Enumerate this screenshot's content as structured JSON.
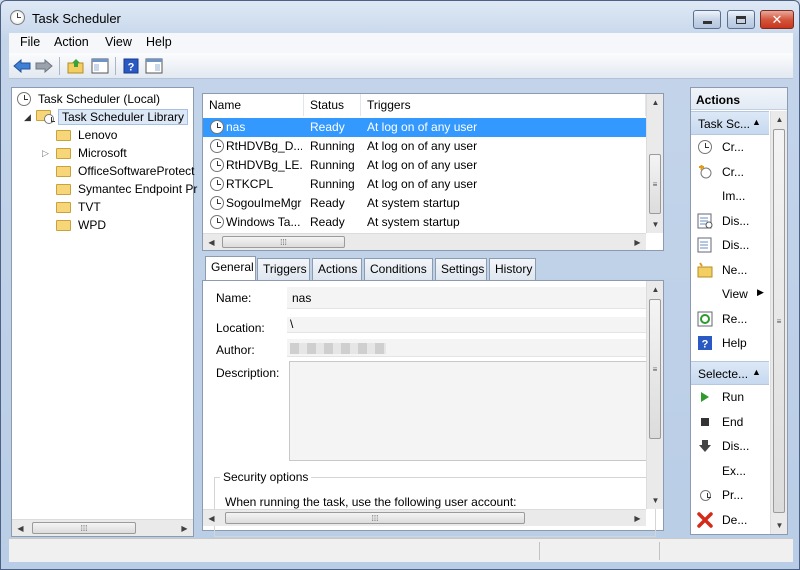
{
  "window": {
    "title": "Task Scheduler"
  },
  "menu": [
    "File",
    "Action",
    "View",
    "Help"
  ],
  "tree": {
    "root": "Task Scheduler (Local)",
    "library": "Task Scheduler Library",
    "folders": [
      "Lenovo",
      "Microsoft",
      "OfficeSoftwareProtect",
      "Symantec Endpoint Pr",
      "TVT",
      "WPD"
    ]
  },
  "tasks": {
    "columns": [
      "Name",
      "Status",
      "Triggers"
    ],
    "rows": [
      {
        "name": "nas",
        "status": "Ready",
        "trigger": "At log on of any user"
      },
      {
        "name": "RtHDVBg_D...",
        "status": "Running",
        "trigger": "At log on of any user"
      },
      {
        "name": "RtHDVBg_LE...",
        "status": "Running",
        "trigger": "At log on of any user"
      },
      {
        "name": "RTKCPL",
        "status": "Running",
        "trigger": "At log on of any user"
      },
      {
        "name": "SogouImeMgr",
        "status": "Ready",
        "trigger": "At system startup"
      },
      {
        "name": "Windows Ta...",
        "status": "Ready",
        "trigger": "At system startup"
      }
    ]
  },
  "details": {
    "tabs": [
      "General",
      "Triggers",
      "Actions",
      "Conditions",
      "Settings",
      "History"
    ],
    "name_label": "Name:",
    "name_value": "nas",
    "location_label": "Location:",
    "location_value": "\\",
    "author_label": "Author:",
    "description_label": "Description:",
    "security_options": "Security options",
    "running_as": "When running the task, use the following user account:"
  },
  "actions": {
    "header": "Actions",
    "section1": "Task Sc...",
    "items1": [
      {
        "icon": "clock-icon",
        "label": "Cr..."
      },
      {
        "icon": "create-task-icon",
        "label": "Cr..."
      },
      {
        "icon": "blank-icon",
        "label": "Im..."
      },
      {
        "icon": "display-running-icon",
        "label": "Dis..."
      },
      {
        "icon": "display-all-icon",
        "label": "Dis..."
      },
      {
        "icon": "new-folder-icon",
        "label": "Ne..."
      },
      {
        "icon": "blank-icon",
        "label": "View"
      },
      {
        "icon": "refresh-icon",
        "label": "Re..."
      },
      {
        "icon": "help-icon",
        "label": "Help"
      }
    ],
    "section2": "Selecte...",
    "items2": [
      {
        "icon": "run-icon",
        "label": "Run"
      },
      {
        "icon": "end-icon",
        "label": "End"
      },
      {
        "icon": "disable-icon",
        "label": "Dis..."
      },
      {
        "icon": "blank-icon",
        "label": "Ex..."
      },
      {
        "icon": "properties-icon",
        "label": "Pr..."
      },
      {
        "icon": "delete-icon",
        "label": "De..."
      }
    ]
  }
}
